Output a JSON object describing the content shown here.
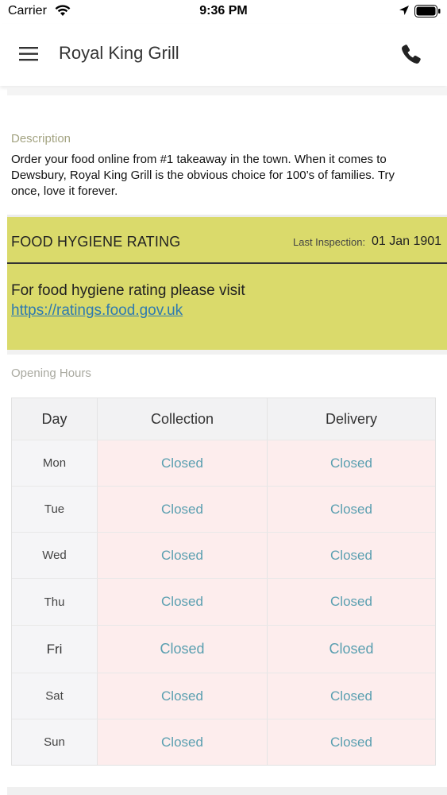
{
  "status_bar": {
    "carrier": "Carrier",
    "time": "9:36 PM"
  },
  "header": {
    "title": "Royal King Grill",
    "menu_icon": "menu-icon",
    "phone_icon": "phone-icon"
  },
  "description": {
    "label": "Description",
    "text": "Order your food online from #1 takeaway in the town. When it comes to Dewsbury, Royal King Grill is the obvious choice for 100’s of families. Try once, love it forever."
  },
  "hygiene": {
    "title": "FOOD HYGIENE RATING",
    "inspection_label": "Last Inspection:",
    "inspection_date": "01 Jan 1901",
    "text": "For food hygiene rating please visit",
    "link": "https://ratings.food.gov.uk"
  },
  "opening_hours": {
    "label": "Opening Hours",
    "columns": [
      "Day",
      "Collection",
      "Delivery"
    ],
    "rows": [
      {
        "day": "Mon",
        "collection": "Closed",
        "delivery": "Closed"
      },
      {
        "day": "Tue",
        "collection": "Closed",
        "delivery": "Closed"
      },
      {
        "day": "Wed",
        "collection": "Closed",
        "delivery": "Closed"
      },
      {
        "day": "Thu",
        "collection": "Closed",
        "delivery": "Closed"
      },
      {
        "day": "Fri",
        "collection": "Closed",
        "delivery": "Closed"
      },
      {
        "day": "Sat",
        "collection": "Closed",
        "delivery": "Closed"
      },
      {
        "day": "Sun",
        "collection": "Closed",
        "delivery": "Closed"
      }
    ]
  },
  "colors": {
    "hygiene_bg": "#dada6b",
    "closed_bg": "#fdeded",
    "closed_text": "#5a9fb0"
  }
}
